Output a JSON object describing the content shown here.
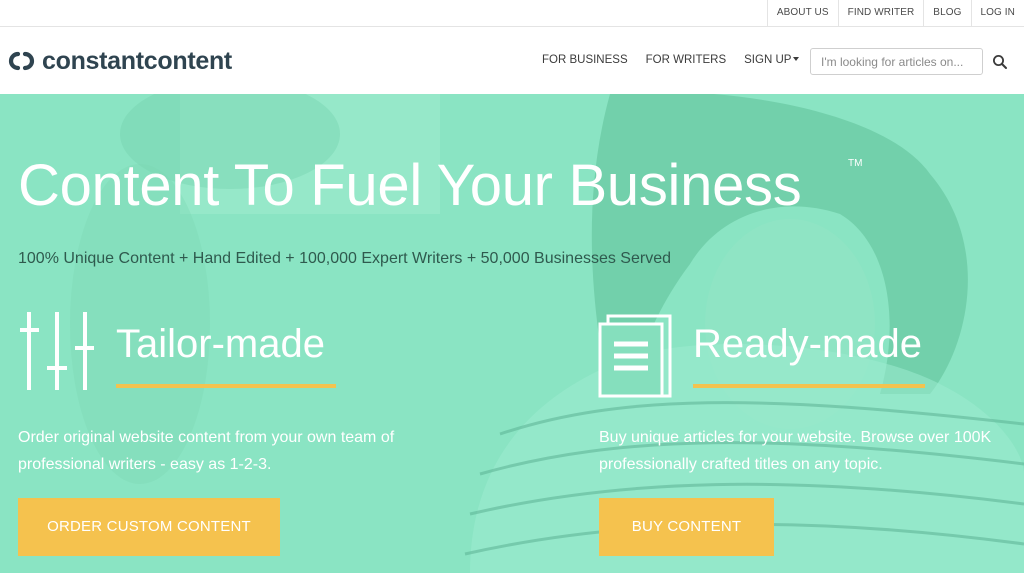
{
  "topbar": {
    "links": [
      "ABOUT US",
      "FIND WRITER",
      "BLOG",
      "LOG IN"
    ]
  },
  "header": {
    "logo_text": "constantcontent",
    "nav": [
      "FOR BUSINESS",
      "FOR WRITERS",
      "SIGN UP"
    ],
    "search_placeholder": "I'm looking for articles on..."
  },
  "hero": {
    "title": "Content To Fuel Your Business",
    "trademark": "TM",
    "subtitle": "100% Unique Content + Hand Edited + 100,000 Expert Writers + 50,000 Businesses Served",
    "tailor": {
      "title": "Tailor-made",
      "desc": "Order original website content from your own team of professional writers - easy as 1-2-3.",
      "button": "ORDER CUSTOM CONTENT"
    },
    "ready": {
      "title": "Ready-made",
      "desc": "Buy unique articles for your website. Browse over 100K professionally crafted titles on any topic.",
      "button": "BUY CONTENT"
    }
  },
  "colors": {
    "accent": "#f5c24e",
    "hero_bg": "#86e0c0",
    "logo": "#2f4450"
  }
}
